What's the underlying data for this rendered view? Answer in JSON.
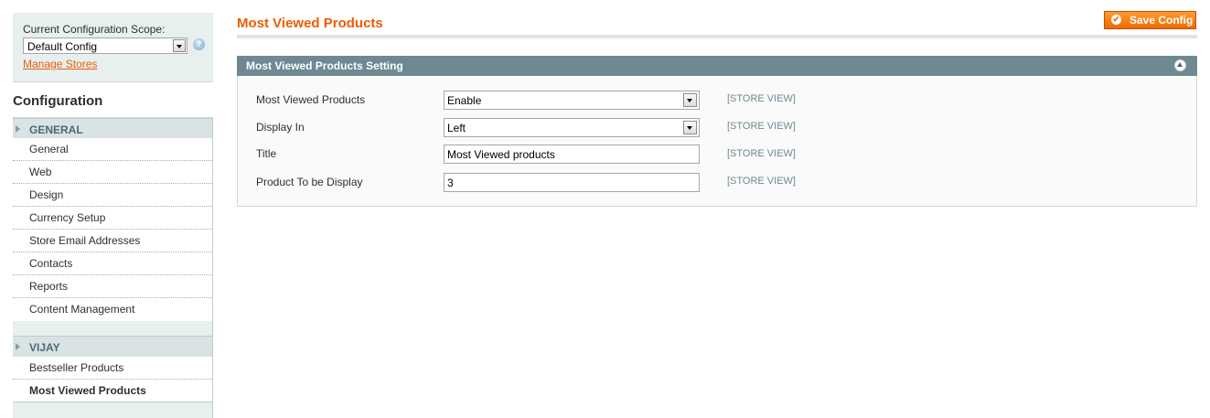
{
  "sidebar": {
    "scope_label": "Current Configuration Scope:",
    "scope_value": "Default Config",
    "manage_stores": "Manage Stores",
    "config_title": "Configuration",
    "sections": [
      {
        "label": "GENERAL",
        "items": [
          "General",
          "Web",
          "Design",
          "Currency Setup",
          "Store Email Addresses",
          "Contacts",
          "Reports",
          "Content Management"
        ]
      },
      {
        "label": "VIJAY",
        "items": [
          "Bestseller Products",
          "Most Viewed Products"
        ]
      }
    ],
    "active_item": "Most Viewed Products"
  },
  "main": {
    "page_title": "Most Viewed Products",
    "save_button": "Save Config",
    "fieldset_title": "Most Viewed Products Setting",
    "rows": [
      {
        "label": "Most Viewed Products",
        "value": "Enable",
        "type": "select",
        "scope": "[STORE VIEW]"
      },
      {
        "label": "Display In",
        "value": "Left",
        "type": "select",
        "scope": "[STORE VIEW]"
      },
      {
        "label": "Title",
        "value": "Most Viewed products",
        "type": "text",
        "scope": "[STORE VIEW]"
      },
      {
        "label": "Product To be Display",
        "value": "3",
        "type": "text",
        "scope": "[STORE VIEW]"
      }
    ]
  },
  "colors": {
    "accent": "#eb5e00",
    "fieldset_header": "#6f8992",
    "sidebar_bg": "#e7efef"
  },
  "icons": {
    "help": "help-icon",
    "save": "checkmark-icon",
    "collapse": "collapse-up-icon",
    "dropdown": "chevron-down-icon",
    "section_arrow": "triangle-right-icon"
  }
}
